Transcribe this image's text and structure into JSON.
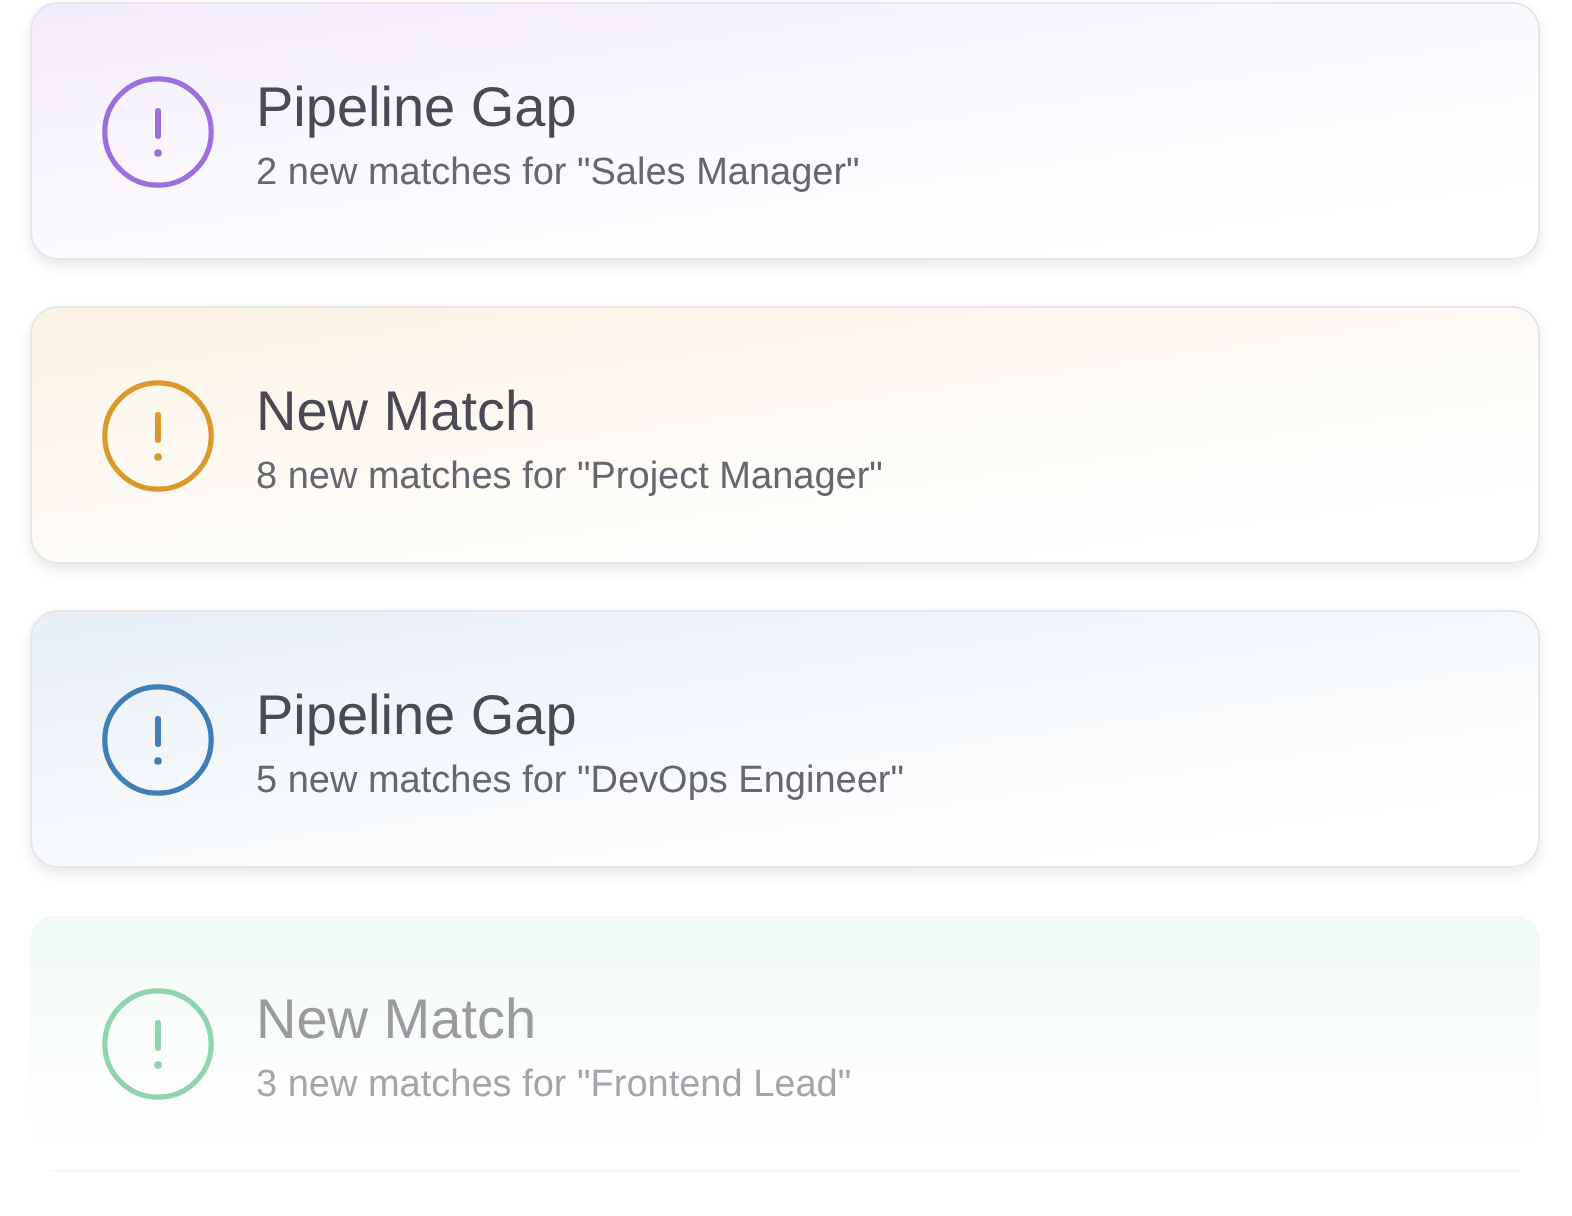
{
  "notifications": [
    {
      "title": "Pipeline Gap",
      "message": "2 new matches for \"Sales Manager\"",
      "color": "#9d6fdc",
      "faded": false
    },
    {
      "title": "New Match",
      "message": "8 new matches for \"Project Manager\"",
      "color": "#d99a2b",
      "faded": false
    },
    {
      "title": "Pipeline Gap",
      "message": "5 new matches for \"DevOps Engineer\"",
      "color": "#3f7fb5",
      "faded": false
    },
    {
      "title": "New Match",
      "message": "3 new matches for \"Frontend Lead\"",
      "color": "#8fd4ae",
      "faded": true
    }
  ]
}
